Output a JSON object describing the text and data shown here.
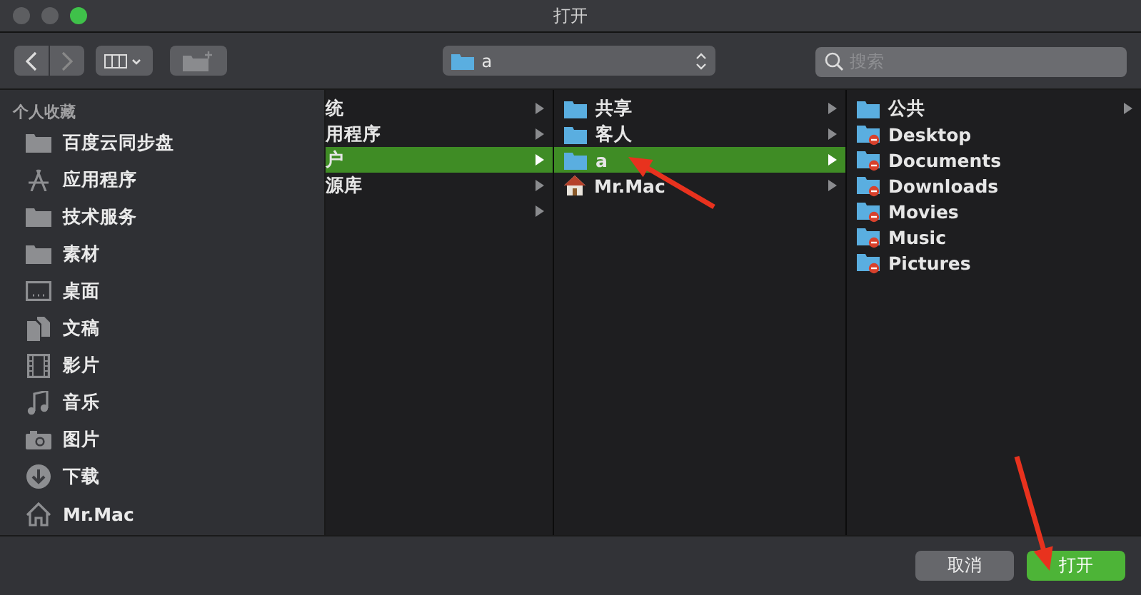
{
  "window": {
    "title": "打开"
  },
  "toolbar": {
    "path": "a",
    "search": {
      "placeholder": "搜索"
    }
  },
  "sidebar": {
    "heading": "个人收藏",
    "items": [
      {
        "label": "百度云同步盘",
        "kind": "folder"
      },
      {
        "label": "应用程序",
        "kind": "apps"
      },
      {
        "label": "技术服务",
        "kind": "folder"
      },
      {
        "label": "素材",
        "kind": "folder"
      },
      {
        "label": "桌面",
        "kind": "desktop"
      },
      {
        "label": "文稿",
        "kind": "docs"
      },
      {
        "label": "影片",
        "kind": "film"
      },
      {
        "label": "音乐",
        "kind": "music"
      },
      {
        "label": "图片",
        "kind": "camera"
      },
      {
        "label": "下载",
        "kind": "download"
      },
      {
        "label": "Mr.Mac",
        "kind": "home"
      }
    ]
  },
  "columns": [
    {
      "items": [
        {
          "label": "统",
          "kind": "plain",
          "selected": false,
          "has_children": true
        },
        {
          "label": "用程序",
          "kind": "plain",
          "selected": false,
          "has_children": true
        },
        {
          "label": "户",
          "kind": "plain",
          "selected": true,
          "has_children": true
        },
        {
          "label": "源库",
          "kind": "plain",
          "selected": false,
          "has_children": true
        },
        {
          "kind": "plain",
          "selected": false,
          "has_children": true
        }
      ]
    },
    {
      "items": [
        {
          "label": "共享",
          "kind": "folder",
          "selected": false,
          "has_children": true
        },
        {
          "label": "客人",
          "kind": "folder",
          "selected": false,
          "has_children": true
        },
        {
          "label": "a",
          "kind": "folder",
          "selected": true,
          "has_children": true
        },
        {
          "label": "Mr.Mac",
          "kind": "home",
          "selected": false,
          "has_children": true
        }
      ]
    },
    {
      "items": [
        {
          "label": "公共",
          "kind": "folder",
          "selected": false,
          "has_children": true
        },
        {
          "label": "Desktop",
          "kind": "locked",
          "selected": false,
          "has_children": false
        },
        {
          "label": "Documents",
          "kind": "locked",
          "selected": false,
          "has_children": false
        },
        {
          "label": "Downloads",
          "kind": "locked",
          "selected": false,
          "has_children": false
        },
        {
          "label": "Movies",
          "kind": "locked",
          "selected": false,
          "has_children": false
        },
        {
          "label": "Music",
          "kind": "locked",
          "selected": false,
          "has_children": false
        },
        {
          "label": "Pictures",
          "kind": "locked",
          "selected": false,
          "has_children": false
        }
      ]
    }
  ],
  "buttons": [
    {
      "label": "取消",
      "kind": "default"
    },
    {
      "label": "打开",
      "kind": "primary"
    }
  ],
  "annotations": [
    {
      "kind": "arrow"
    },
    {
      "kind": "arrow"
    }
  ]
}
